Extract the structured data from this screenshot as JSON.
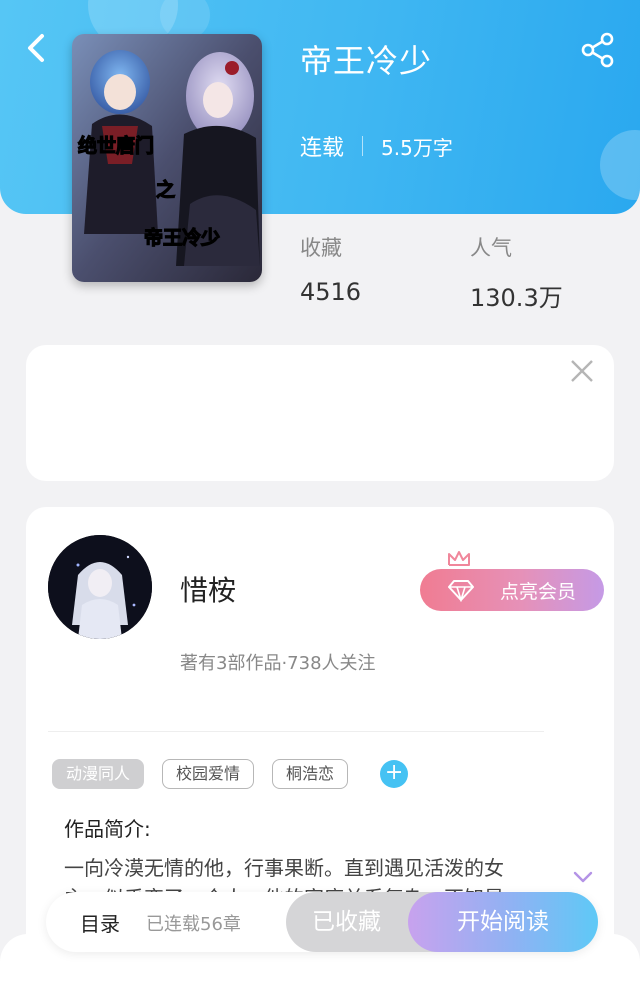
{
  "header": {
    "title": "帝王冷少",
    "status": "连载",
    "word_count": "5.5万字",
    "back_icon": "back-arrow-icon",
    "share_icon": "share-icon"
  },
  "cover": {
    "title_line1": "绝世唐门",
    "title_line2": "之",
    "title_line3": "帝王冷少"
  },
  "stats": {
    "favorites_label": "收藏",
    "favorites_value": "4516",
    "popularity_label": "人气",
    "popularity_value": "130.3万"
  },
  "author": {
    "name": "惜桉",
    "meta": "著有3部作品·738人关注",
    "vip_label": "点亮会员"
  },
  "tags": [
    "动漫同人",
    "校园爱情",
    "桐浩恋"
  ],
  "intro": {
    "title": "作品简介:",
    "text": "一向冷漠无情的他，行事果断。直到遇见活泼的女主，似乎变了一个人。他的家庭关系复杂，不知是"
  },
  "bottom_bar": {
    "toc_label": "目录",
    "chapter_count": "已连载56章",
    "collected_label": "已收藏",
    "read_label": "开始阅读"
  },
  "colors": {
    "header_blue": "#40b7f2",
    "accent_blue": "#45c2f3",
    "vip_pink": "#f07c92",
    "vip_purple": "#c59ae6"
  }
}
